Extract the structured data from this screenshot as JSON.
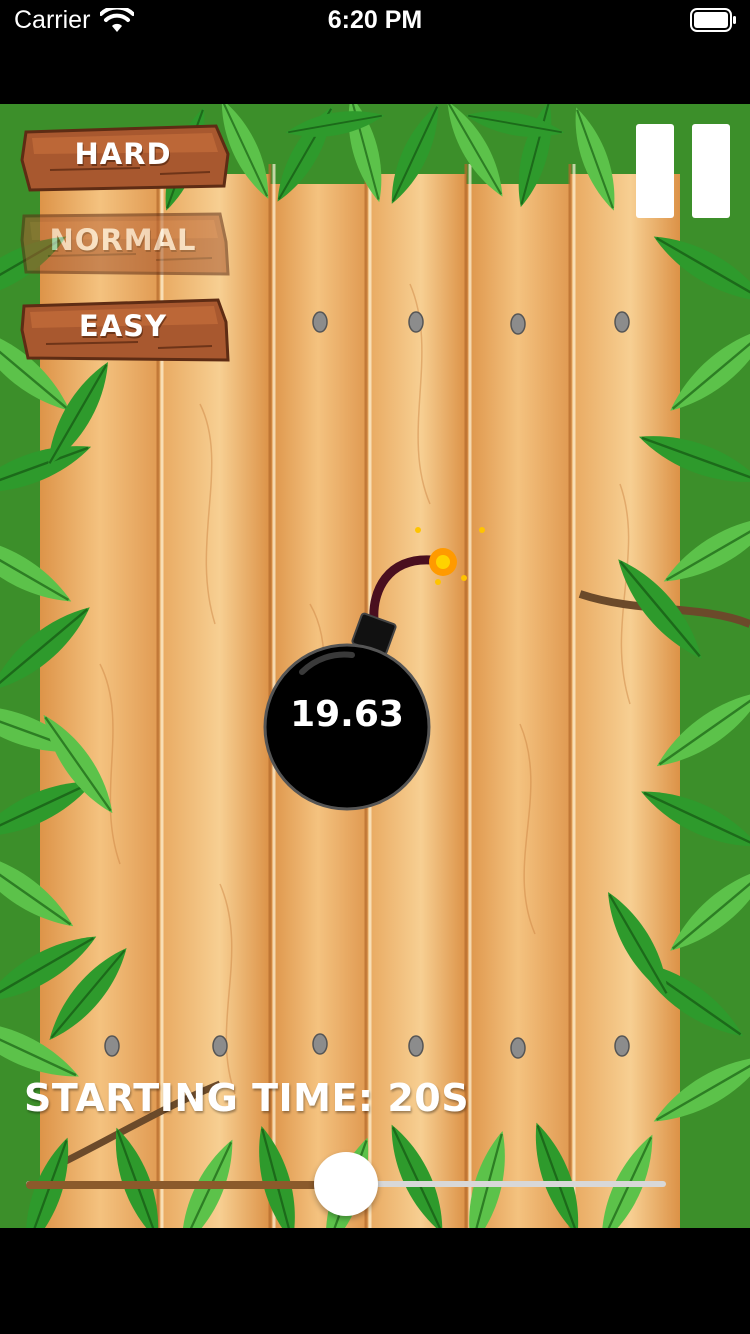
{
  "status_bar": {
    "carrier": "Carrier",
    "time": "6:20 PM",
    "wifi_icon": "wifi-icon",
    "battery_icon": "battery-icon"
  },
  "difficulty": {
    "hard": "HARD",
    "normal": "NORMAL",
    "easy": "EASY",
    "selected": "NORMAL"
  },
  "pause_icon": "pause-icon",
  "bomb": {
    "icon": "bomb-icon",
    "timer": "19.63"
  },
  "starting_time": {
    "label": "STARTING TIME: 20S",
    "slider_fraction": 0.5
  },
  "colors": {
    "wood": "#e8a45c",
    "leaves": "#2f8f2a",
    "slider_fill": "#8b5a2b",
    "bomb": "#000000"
  }
}
